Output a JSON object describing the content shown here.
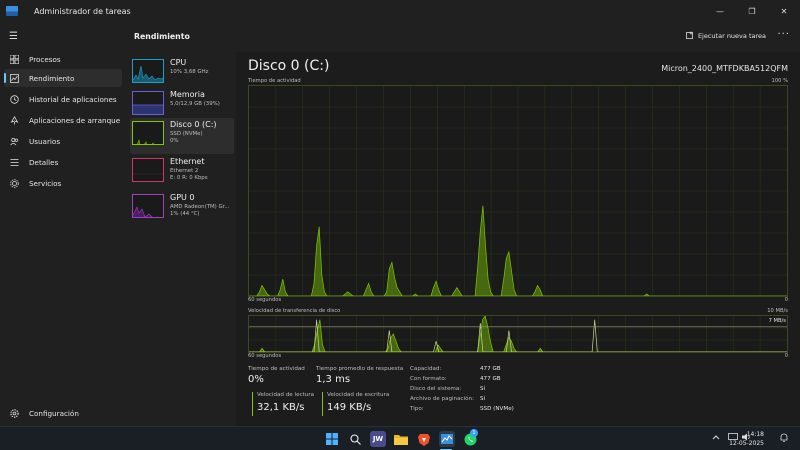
{
  "window": {
    "title": "Administrador de tareas",
    "controls": {
      "minimize": "—",
      "maximize": "❐",
      "close": "✕"
    }
  },
  "nav": {
    "items": [
      {
        "label": "Procesos",
        "icon": "grid-icon"
      },
      {
        "label": "Rendimiento",
        "icon": "performance-icon",
        "active": true
      },
      {
        "label": "Historial de aplicaciones",
        "icon": "history-icon"
      },
      {
        "label": "Aplicaciones de arranque",
        "icon": "startup-icon"
      },
      {
        "label": "Usuarios",
        "icon": "users-icon"
      },
      {
        "label": "Detalles",
        "icon": "details-icon"
      },
      {
        "label": "Servicios",
        "icon": "services-icon"
      }
    ],
    "settings": "Configuración"
  },
  "header": {
    "section_title": "Rendimiento",
    "run_task": "Ejecutar nueva tarea",
    "more": "···"
  },
  "perf_list": [
    {
      "name": "CPU",
      "sub": "10%  3,68 GHz",
      "sub2": "",
      "color": "#1aa0c9"
    },
    {
      "name": "Memoria",
      "sub": "5,0/12,9 GB (39%)",
      "sub2": "",
      "color": "#6b5fd6"
    },
    {
      "name": "Disco 0 (C:)",
      "sub": "SSD (NVMe)",
      "sub2": "0%",
      "color": "#7ec800",
      "active": true
    },
    {
      "name": "Ethernet",
      "sub": "Ethernet 2",
      "sub2": "E: 0 R: 0 Kbps",
      "color": "#c9376b"
    },
    {
      "name": "GPU 0",
      "sub": "AMD Radeon(TM) Gr...",
      "sub2": "1% (44 °C)",
      "color": "#a040c0"
    }
  ],
  "main": {
    "title": "Disco 0 (C:)",
    "model": "Micron_2400_MTFDKBA512QFM",
    "graph1": {
      "label": "Tiempo de actividad",
      "max_label": "100 %",
      "time_label": "60 segundos",
      "min_label": "0",
      "values": [
        0,
        0,
        0,
        0,
        2,
        5,
        3,
        1,
        0,
        0,
        0,
        0,
        3,
        8,
        2,
        0,
        0,
        0,
        0,
        0,
        0,
        0,
        0,
        0,
        0,
        6,
        24,
        33,
        10,
        2,
        0,
        0,
        0,
        0,
        0,
        0,
        0,
        1,
        2,
        1,
        0,
        0,
        0,
        0,
        0,
        3,
        6,
        2,
        0,
        0,
        0,
        0,
        0,
        2,
        13,
        16,
        9,
        4,
        2,
        0,
        0,
        0,
        0,
        0,
        1,
        0,
        0,
        0,
        0,
        0,
        0,
        4,
        7,
        3,
        0,
        0,
        0,
        0,
        0,
        2,
        4,
        2,
        0,
        0,
        0,
        0,
        0,
        0,
        14,
        31,
        43,
        24,
        8,
        2,
        0,
        0,
        0,
        0,
        8,
        18,
        21,
        12,
        3,
        0,
        0,
        0,
        0,
        0,
        0,
        0,
        2,
        5,
        3,
        0,
        0,
        0,
        0,
        0,
        0,
        0,
        0,
        0,
        0,
        0,
        0,
        0,
        0,
        0,
        0,
        0,
        0,
        0,
        0,
        0,
        0,
        0,
        0,
        0,
        0,
        0,
        0,
        0,
        0,
        0,
        0,
        0,
        0,
        0,
        0,
        0,
        0,
        0,
        0,
        1,
        0,
        0,
        0,
        0,
        0,
        0,
        0,
        0,
        0,
        0,
        0,
        0,
        0,
        0,
        0,
        0,
        0,
        0,
        0,
        0,
        0,
        0,
        0,
        0,
        0,
        0,
        0,
        0,
        0,
        0,
        0,
        0,
        0,
        0,
        0,
        0,
        0,
        0,
        0,
        0,
        0,
        0,
        0,
        0,
        0,
        0,
        0,
        0,
        0,
        0,
        0,
        0,
        0,
        0
      ]
    },
    "graph2": {
      "label": "Velocidad de transferencia de disco",
      "max_label": "10 MB/s",
      "line_label": "7 MB/s",
      "time_label": "60 segundos",
      "min_label": "0",
      "line_value": 7,
      "max": 10,
      "read_values": [
        0,
        0,
        0,
        0,
        0,
        1,
        0,
        0,
        0,
        0,
        0,
        0,
        0,
        0,
        0,
        0,
        0,
        0,
        0,
        0,
        0,
        0,
        0,
        0,
        0,
        2,
        6,
        9,
        2,
        0,
        0,
        0,
        0,
        0,
        0,
        0,
        0,
        0,
        0,
        0,
        0,
        0,
        0,
        0,
        0,
        0,
        0,
        0,
        0,
        0,
        0,
        0,
        0,
        1,
        4,
        5,
        3,
        1,
        0,
        0,
        0,
        0,
        0,
        0,
        0,
        0,
        0,
        0,
        0,
        0,
        0,
        0,
        2,
        1,
        0,
        0,
        0,
        0,
        0,
        0,
        0,
        0,
        0,
        0,
        0,
        0,
        0,
        0,
        4,
        9,
        10,
        7,
        3,
        0,
        0,
        0,
        0,
        0,
        2,
        4,
        3,
        1,
        0,
        0,
        0,
        0,
        0,
        0,
        0,
        0,
        0,
        1,
        0,
        0,
        0,
        0,
        0,
        0,
        0,
        0,
        0,
        0,
        0,
        0,
        0,
        0,
        0,
        0,
        0,
        0,
        0,
        0,
        0,
        0,
        0,
        0,
        0,
        0,
        0,
        0,
        0,
        0,
        0,
        0,
        0,
        0,
        0,
        0,
        0,
        0,
        0,
        0,
        0,
        0,
        0,
        0,
        0,
        0,
        0,
        0,
        0,
        0,
        0,
        0,
        0,
        0,
        0,
        0,
        0,
        0,
        0,
        0,
        0,
        0,
        0,
        0,
        0,
        0,
        0,
        0,
        0,
        0,
        0,
        0,
        0,
        0,
        0,
        0,
        0,
        0,
        0,
        0,
        0,
        0,
        0,
        0,
        0,
        0,
        0,
        0,
        0,
        0,
        0,
        0,
        0,
        0
      ],
      "write_values": [
        0,
        0,
        0,
        0,
        0,
        0,
        0,
        0,
        0,
        0,
        0,
        0,
        0,
        0,
        0,
        0,
        0,
        0,
        0,
        0,
        0,
        0,
        0,
        0,
        0,
        0,
        9,
        0,
        0,
        0,
        0,
        0,
        0,
        0,
        0,
        0,
        0,
        0,
        0,
        0,
        0,
        0,
        0,
        0,
        0,
        0,
        0,
        0,
        0,
        0,
        0,
        0,
        0,
        0,
        6,
        0,
        0,
        0,
        0,
        0,
        0,
        0,
        0,
        0,
        0,
        0,
        0,
        0,
        0,
        0,
        0,
        0,
        3,
        0,
        0,
        0,
        0,
        0,
        0,
        0,
        0,
        0,
        0,
        0,
        0,
        0,
        0,
        0,
        0,
        8,
        0,
        0,
        0,
        0,
        0,
        0,
        0,
        0,
        0,
        0,
        6,
        0,
        0,
        0,
        0,
        0,
        0,
        0,
        0,
        0,
        0,
        0,
        0,
        0,
        0,
        0,
        0,
        0,
        0,
        0,
        0,
        0,
        0,
        0,
        0,
        0,
        0,
        0,
        0,
        0,
        0,
        0,
        0,
        9,
        0,
        0,
        0,
        0,
        0,
        0,
        0,
        0,
        0,
        0,
        0,
        0,
        0,
        0,
        0,
        0,
        0,
        0,
        0,
        0,
        0,
        0,
        0,
        0,
        0,
        0,
        0,
        0,
        0,
        0,
        0,
        0,
        0,
        0,
        0,
        0,
        0,
        0,
        0,
        0,
        0,
        0,
        0,
        0,
        0,
        0,
        0,
        0,
        0,
        0,
        0,
        0,
        0,
        0,
        0,
        0,
        0,
        0,
        0,
        0,
        0,
        0,
        0,
        0,
        0,
        0,
        0,
        0,
        0,
        0,
        0,
        0,
        0,
        0
      ]
    },
    "stats": {
      "activity_label": "Tiempo de actividad",
      "activity_value": "0%",
      "response_label": "Tiempo promedio de respuesta",
      "response_value": "1,3 ms",
      "read_label": "Velocidad de lectura",
      "read_value": "32,1 KB/s",
      "write_label": "Velocidad de escritura",
      "write_value": "149 KB/s"
    },
    "info": [
      {
        "key": "Capacidad:",
        "value": "477 GB"
      },
      {
        "key": "Con formato:",
        "value": "477 GB"
      },
      {
        "key": "Disco del sistema:",
        "value": "Sí"
      },
      {
        "key": "Archivo de paginación:",
        "value": "Sí"
      },
      {
        "key": "Tipo:",
        "value": "SSD (NVMe)"
      }
    ]
  },
  "taskbar": {
    "apps": [
      {
        "name": "start-icon",
        "text": "",
        "color": "#2a8cff"
      },
      {
        "name": "search-icon",
        "text": "⚲",
        "color": "transparent"
      },
      {
        "name": "jw-app-icon",
        "text": "JW",
        "color": "#4a4a8c"
      },
      {
        "name": "file-explorer-icon",
        "text": "",
        "color": "#e8b52c"
      },
      {
        "name": "brave-browser-icon",
        "text": "",
        "color": "#f0502a"
      },
      {
        "name": "task-manager-icon",
        "text": "",
        "color": "#3b8fe0"
      },
      {
        "name": "whatsapp-icon",
        "text": "",
        "color": "#25d366"
      }
    ],
    "whatsapp_badge": "1",
    "time": "14:18",
    "date": "12-05-2025"
  }
}
